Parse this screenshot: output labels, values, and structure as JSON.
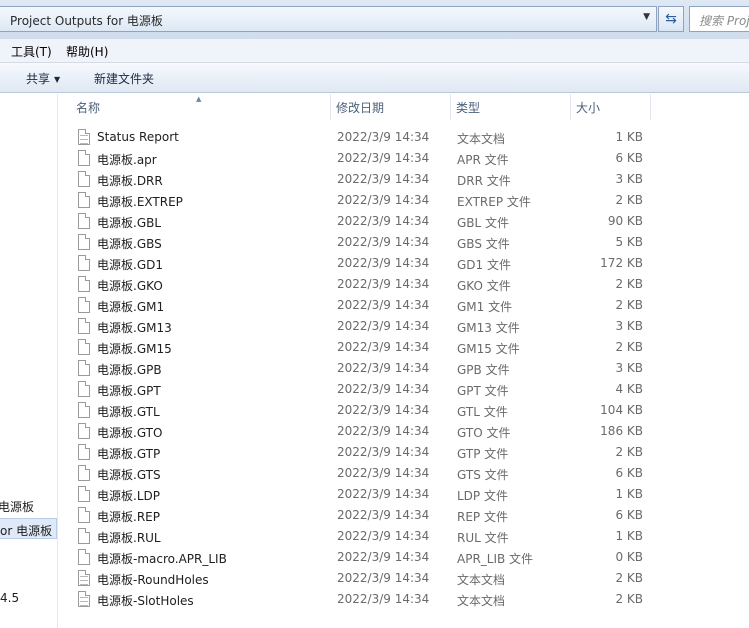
{
  "address": {
    "path": "Project Outputs for 电源板"
  },
  "search": {
    "placeholder": "搜索 Proj"
  },
  "menu": {
    "tools": "工具(T)",
    "help": "帮助(H)"
  },
  "toolbar": {
    "share": "共享",
    "new_folder": "新建文件夹"
  },
  "nav": {
    "items": [
      "电源板",
      "or 电源板",
      "4.5"
    ]
  },
  "columns": {
    "name": "名称",
    "date": "修改日期",
    "type": "类型",
    "size": "大小"
  },
  "files": [
    {
      "name": "Status Report",
      "date": "2022/3/9 14:34",
      "type": "文本文档",
      "size": "1 KB",
      "icon": "text-file-icon"
    },
    {
      "name": "电源板.apr",
      "date": "2022/3/9 14:34",
      "type": "APR 文件",
      "size": "6 KB",
      "icon": "file-icon"
    },
    {
      "name": "电源板.DRR",
      "date": "2022/3/9 14:34",
      "type": "DRR 文件",
      "size": "3 KB",
      "icon": "file-icon"
    },
    {
      "name": "电源板.EXTREP",
      "date": "2022/3/9 14:34",
      "type": "EXTREP 文件",
      "size": "2 KB",
      "icon": "file-icon"
    },
    {
      "name": "电源板.GBL",
      "date": "2022/3/9 14:34",
      "type": "GBL 文件",
      "size": "90 KB",
      "icon": "file-icon"
    },
    {
      "name": "电源板.GBS",
      "date": "2022/3/9 14:34",
      "type": "GBS 文件",
      "size": "5 KB",
      "icon": "file-icon"
    },
    {
      "name": "电源板.GD1",
      "date": "2022/3/9 14:34",
      "type": "GD1 文件",
      "size": "172 KB",
      "icon": "file-icon"
    },
    {
      "name": "电源板.GKO",
      "date": "2022/3/9 14:34",
      "type": "GKO 文件",
      "size": "2 KB",
      "icon": "file-icon"
    },
    {
      "name": "电源板.GM1",
      "date": "2022/3/9 14:34",
      "type": "GM1 文件",
      "size": "2 KB",
      "icon": "file-icon"
    },
    {
      "name": "电源板.GM13",
      "date": "2022/3/9 14:34",
      "type": "GM13 文件",
      "size": "3 KB",
      "icon": "file-icon"
    },
    {
      "name": "电源板.GM15",
      "date": "2022/3/9 14:34",
      "type": "GM15 文件",
      "size": "2 KB",
      "icon": "file-icon"
    },
    {
      "name": "电源板.GPB",
      "date": "2022/3/9 14:34",
      "type": "GPB 文件",
      "size": "3 KB",
      "icon": "file-icon"
    },
    {
      "name": "电源板.GPT",
      "date": "2022/3/9 14:34",
      "type": "GPT 文件",
      "size": "4 KB",
      "icon": "file-icon"
    },
    {
      "name": "电源板.GTL",
      "date": "2022/3/9 14:34",
      "type": "GTL 文件",
      "size": "104 KB",
      "icon": "file-icon"
    },
    {
      "name": "电源板.GTO",
      "date": "2022/3/9 14:34",
      "type": "GTO 文件",
      "size": "186 KB",
      "icon": "file-icon"
    },
    {
      "name": "电源板.GTP",
      "date": "2022/3/9 14:34",
      "type": "GTP 文件",
      "size": "2 KB",
      "icon": "file-icon"
    },
    {
      "name": "电源板.GTS",
      "date": "2022/3/9 14:34",
      "type": "GTS 文件",
      "size": "6 KB",
      "icon": "file-icon"
    },
    {
      "name": "电源板.LDP",
      "date": "2022/3/9 14:34",
      "type": "LDP 文件",
      "size": "1 KB",
      "icon": "file-icon"
    },
    {
      "name": "电源板.REP",
      "date": "2022/3/9 14:34",
      "type": "REP 文件",
      "size": "6 KB",
      "icon": "file-icon"
    },
    {
      "name": "电源板.RUL",
      "date": "2022/3/9 14:34",
      "type": "RUL 文件",
      "size": "1 KB",
      "icon": "file-icon"
    },
    {
      "name": "电源板-macro.APR_LIB",
      "date": "2022/3/9 14:34",
      "type": "APR_LIB 文件",
      "size": "0 KB",
      "icon": "file-icon"
    },
    {
      "name": "电源板-RoundHoles",
      "date": "2022/3/9 14:34",
      "type": "文本文档",
      "size": "2 KB",
      "icon": "text-file-icon"
    },
    {
      "name": "电源板-SlotHoles",
      "date": "2022/3/9 14:34",
      "type": "文本文档",
      "size": "2 KB",
      "icon": "text-file-icon"
    }
  ]
}
